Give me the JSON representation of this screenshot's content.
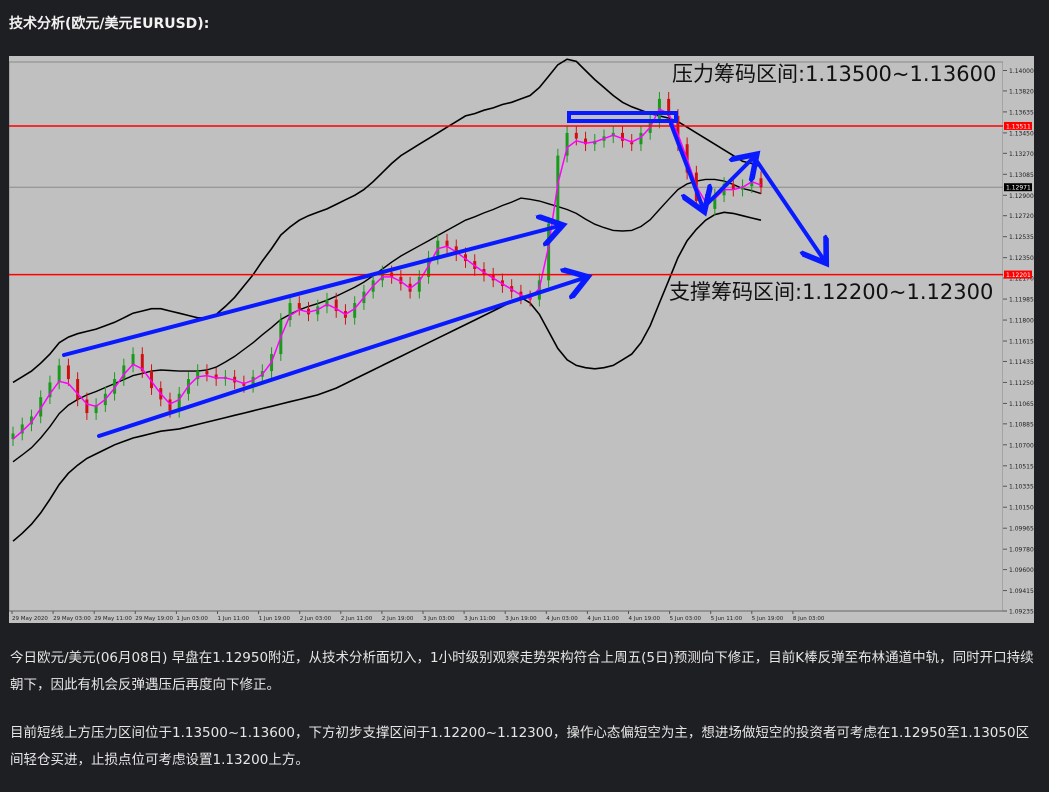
{
  "heading": "技术分析(欧元/美元EURUSD):",
  "paragraphs": [
    "今日欧元/美元(06月08日) 早盘在1.12950附近，从技术分析面切入，1小时级别观察走势架构符合上周五(5日)预测向下修正，目前K棒反弹至布林通道中轨，同时开口持续朝下，因此有机会反弹遇压后再度向下修正。",
    "目前短线上方压力区间位于1.13500~1.13600，下方初步支撑区间于1.12200~1.12300，操作心态偏短空为主，想进场做短空的投资者可考虑在1.12950至1.13050区间轻仓买进，止损点位可考虑设置1.13200上方。"
  ],
  "colors": {
    "background": "#1e1f22",
    "chart_bg": "#c0c0c0",
    "bull_candle": "#1a9a1a",
    "bear_candle": "#d01010",
    "ma_line": "#ff00ff",
    "bands": "#000000",
    "hline": "#ff0000",
    "arrows": "#0a1aff"
  },
  "chart_data": {
    "type": "candlestick",
    "ylim": [
      1.09235,
      1.14075
    ],
    "y_ticks": [
      "1.14000",
      "1.13820",
      "1.13635",
      "1.13450",
      "1.13270",
      "1.13085",
      "1.12900",
      "1.12720",
      "1.12535",
      "1.12350",
      "1.12170",
      "1.11985",
      "1.11800",
      "1.11615",
      "1.11435",
      "1.11250",
      "1.11065",
      "1.10885",
      "1.10700",
      "1.10515",
      "1.10335",
      "1.10150",
      "1.09965",
      "1.09780",
      "1.09600",
      "1.09415",
      "1.09235"
    ],
    "x_ticks": [
      "29 May 2020",
      "29 May 03:00",
      "29 May 11:00",
      "29 May 19:00",
      "1 Jun 03:00",
      "1 Jun 11:00",
      "1 Jun 19:00",
      "2 Jun 03:00",
      "2 Jun 11:00",
      "2 Jun 19:00",
      "3 Jun 03:00",
      "3 Jun 11:00",
      "3 Jun 19:00",
      "4 Jun 03:00",
      "4 Jun 11:00",
      "4 Jun 19:00",
      "5 Jun 03:00",
      "5 Jun 11:00",
      "5 Jun 19:00",
      "8 Jun 03:00"
    ],
    "current_price": "1.12971",
    "resistance_price": "1.13511",
    "support_price": "1.12201",
    "resistance_label": "压力筹码区间:1.13500~1.13600",
    "support_label": "支撑筹码区间:1.12200~1.12300",
    "close": [
      1.108,
      1.1088,
      1.1095,
      1.1112,
      1.1125,
      1.114,
      1.1128,
      1.111,
      1.1098,
      1.1105,
      1.1115,
      1.1128,
      1.114,
      1.115,
      1.1135,
      1.112,
      1.111,
      1.11,
      1.1115,
      1.1128,
      1.1135,
      1.1132,
      1.1128,
      1.113,
      1.1125,
      1.1122,
      1.113,
      1.1135,
      1.115,
      1.118,
      1.1195,
      1.119,
      1.1185,
      1.1192,
      1.1198,
      1.1188,
      1.1182,
      1.1195,
      1.1205,
      1.1215,
      1.1222,
      1.1218,
      1.1212,
      1.1205,
      1.1218,
      1.1235,
      1.125,
      1.1245,
      1.1238,
      1.1232,
      1.1225,
      1.122,
      1.1215,
      1.121,
      1.1205,
      1.12,
      1.1198,
      1.1215,
      1.1265,
      1.1325,
      1.1345,
      1.134,
      1.1335,
      1.1338,
      1.1342,
      1.1345,
      1.1338,
      1.1335,
      1.1345,
      1.1355,
      1.1375,
      1.136,
      1.1335,
      1.131,
      1.1285,
      1.1278,
      1.129,
      1.13,
      1.1295,
      1.1298,
      1.1305,
      1.1297
    ],
    "ma": [
      1.1075,
      1.1082,
      1.109,
      1.1102,
      1.1115,
      1.1126,
      1.1124,
      1.1115,
      1.1106,
      1.1104,
      1.111,
      1.112,
      1.1132,
      1.1141,
      1.1137,
      1.1126,
      1.1115,
      1.1106,
      1.111,
      1.1122,
      1.113,
      1.1131,
      1.1129,
      1.1129,
      1.1127,
      1.1124,
      1.1127,
      1.1132,
      1.1143,
      1.1165,
      1.1184,
      1.1189,
      1.1187,
      1.1189,
      1.1194,
      1.119,
      1.1185,
      1.119,
      1.12,
      1.121,
      1.1218,
      1.1218,
      1.1214,
      1.1208,
      1.1214,
      1.1228,
      1.1243,
      1.1245,
      1.124,
      1.1234,
      1.1228,
      1.1222,
      1.1217,
      1.1212,
      1.1207,
      1.1202,
      1.1199,
      1.1208,
      1.1245,
      1.13,
      1.1332,
      1.1338,
      1.1336,
      1.1337,
      1.134,
      1.1343,
      1.134,
      1.1337,
      1.1341,
      1.135,
      1.1366,
      1.1362,
      1.1344,
      1.1322,
      1.1298,
      1.1284,
      1.1287,
      1.1295,
      1.1295,
      1.1297,
      1.1302,
      1.1299
    ],
    "upper_band": [
      1.1125,
      1.113,
      1.1135,
      1.1142,
      1.115,
      1.116,
      1.1165,
      1.1168,
      1.117,
      1.1172,
      1.1175,
      1.1178,
      1.1182,
      1.1186,
      1.1188,
      1.119,
      1.119,
      1.1188,
      1.1186,
      1.1184,
      1.1182,
      1.1182,
      1.1185,
      1.1192,
      1.12,
      1.121,
      1.122,
      1.1232,
      1.1243,
      1.1255,
      1.1262,
      1.1268,
      1.1272,
      1.1275,
      1.1278,
      1.1282,
      1.1286,
      1.129,
      1.1295,
      1.1302,
      1.131,
      1.1318,
      1.1325,
      1.133,
      1.1335,
      1.134,
      1.1345,
      1.135,
      1.1355,
      1.136,
      1.1362,
      1.1365,
      1.1367,
      1.137,
      1.1372,
      1.1375,
      1.1378,
      1.1385,
      1.1395,
      1.1405,
      1.141,
      1.1408,
      1.14,
      1.1392,
      1.1385,
      1.1378,
      1.1372,
      1.1368,
      1.1365,
      1.1362,
      1.136,
      1.1358,
      1.1355,
      1.135,
      1.1345,
      1.134,
      1.1335,
      1.133,
      1.1325,
      1.132,
      1.1318,
      1.1315
    ],
    "lower_band": [
      1.0985,
      1.0992,
      1.1,
      1.101,
      1.1022,
      1.1035,
      1.1045,
      1.1052,
      1.1058,
      1.1062,
      1.1066,
      1.107,
      1.1073,
      1.1076,
      1.1078,
      1.108,
      1.1082,
      1.1083,
      1.1084,
      1.1086,
      1.1088,
      1.109,
      1.1092,
      1.1094,
      1.1096,
      1.1098,
      1.11,
      1.1102,
      1.1104,
      1.1106,
      1.1108,
      1.111,
      1.1112,
      1.1114,
      1.1117,
      1.112,
      1.1124,
      1.1128,
      1.1132,
      1.1136,
      1.114,
      1.1144,
      1.1148,
      1.1152,
      1.1156,
      1.116,
      1.1164,
      1.1168,
      1.1172,
      1.1176,
      1.118,
      1.1184,
      1.1188,
      1.1192,
      1.1196,
      1.12,
      1.1195,
      1.1185,
      1.117,
      1.1155,
      1.1145,
      1.114,
      1.1138,
      1.1137,
      1.1138,
      1.114,
      1.1145,
      1.115,
      1.116,
      1.1175,
      1.1195,
      1.1215,
      1.1235,
      1.125,
      1.126,
      1.1268,
      1.1273,
      1.1275,
      1.1274,
      1.1272,
      1.127,
      1.1268
    ]
  }
}
